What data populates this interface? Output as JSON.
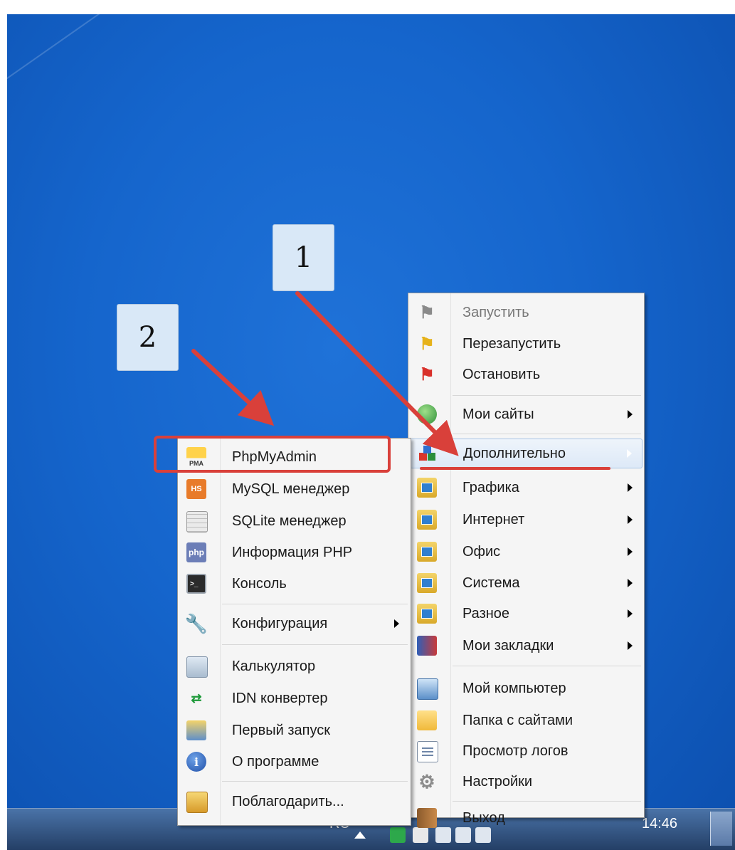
{
  "taskbar": {
    "language": "RU",
    "clock": "14:46"
  },
  "callouts": [
    "1",
    "2"
  ],
  "main_menu": {
    "items": [
      {
        "label": "Запустить",
        "icon": "flag-gray-icon",
        "disabled": true
      },
      {
        "label": "Перезапустить",
        "icon": "flag-yellow-icon"
      },
      {
        "label": "Остановить",
        "icon": "flag-red-icon"
      },
      {
        "label": "Мои сайты",
        "icon": "globe-icon",
        "submenu": true
      },
      {
        "label": "Дополнительно",
        "icon": "blocks-icon",
        "submenu": true,
        "highlighted": true
      },
      {
        "label": "Графика",
        "icon": "folder-app-icon",
        "submenu": true
      },
      {
        "label": "Интернет",
        "icon": "folder-app-icon",
        "submenu": true
      },
      {
        "label": "Офис",
        "icon": "folder-app-icon",
        "submenu": true
      },
      {
        "label": "Система",
        "icon": "folder-app-icon",
        "submenu": true
      },
      {
        "label": "Разное",
        "icon": "folder-app-icon",
        "submenu": true
      },
      {
        "label": "Мои закладки",
        "icon": "bookmarks-icon",
        "submenu": true
      },
      {
        "label": "Мой компьютер",
        "icon": "computer-icon"
      },
      {
        "label": "Папка с сайтами",
        "icon": "folder-icon"
      },
      {
        "label": "Просмотр логов",
        "icon": "log-icon"
      },
      {
        "label": "Настройки",
        "icon": "gear-icon"
      },
      {
        "label": "Выход",
        "icon": "exit-door-icon"
      }
    ]
  },
  "sub_menu": {
    "items": [
      {
        "label": "PhpMyAdmin",
        "icon": "pma-icon",
        "icon_text": "PMA"
      },
      {
        "label": "MySQL менеджер",
        "icon": "mysql-manager-icon",
        "icon_text": "HS"
      },
      {
        "label": "SQLite менеджер",
        "icon": "sqlite-icon"
      },
      {
        "label": "Информация PHP",
        "icon": "php-icon",
        "icon_text": "php"
      },
      {
        "label": "Консоль",
        "icon": "console-icon"
      },
      {
        "label": "Конфигурация",
        "icon": "wrench-icon",
        "submenu": true
      },
      {
        "label": "Калькулятор",
        "icon": "calculator-icon"
      },
      {
        "label": "IDN конвертер",
        "icon": "idn-converter-icon"
      },
      {
        "label": "Первый запуск",
        "icon": "first-run-icon"
      },
      {
        "label": "О программе",
        "icon": "info-icon"
      },
      {
        "label": "Поблагодарить...",
        "icon": "thanks-icon"
      }
    ]
  },
  "colors": {
    "desktop": "#1565cc",
    "annotation": "#d9403a",
    "callout_bg": "#d9e8f7"
  }
}
